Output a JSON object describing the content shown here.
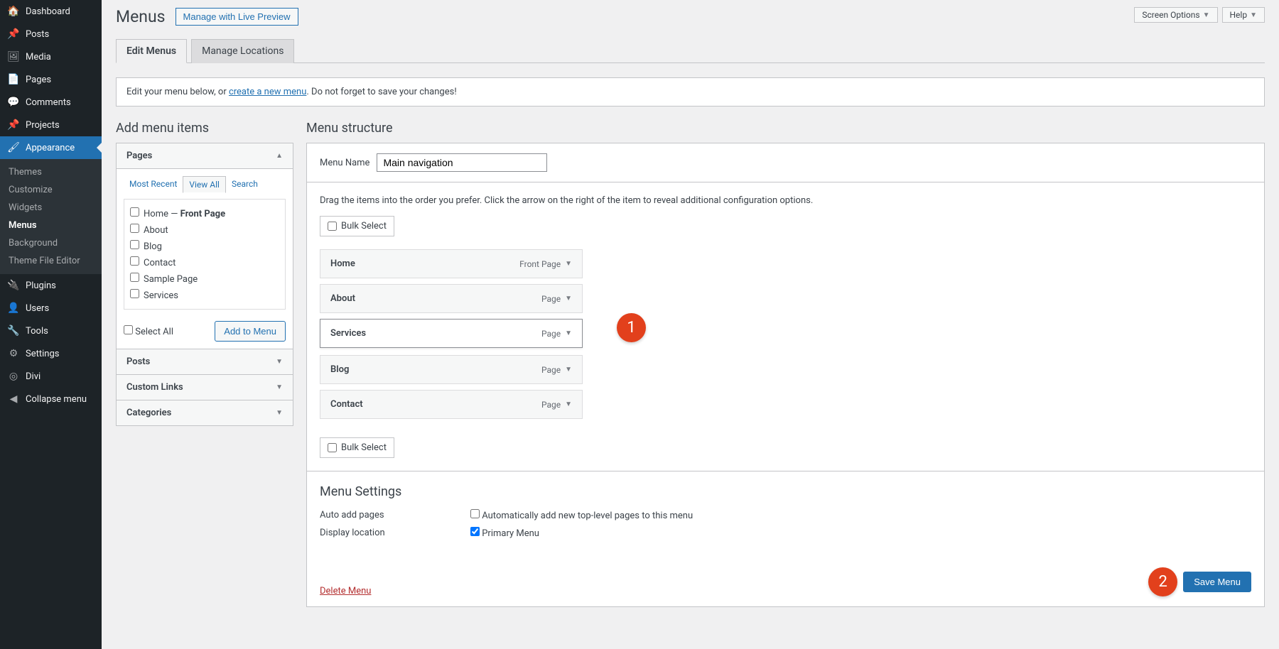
{
  "sidebar": {
    "items": [
      {
        "label": "Dashboard",
        "icon": "🏠"
      },
      {
        "label": "Posts",
        "icon": "📌"
      },
      {
        "label": "Media",
        "icon": "🖼"
      },
      {
        "label": "Pages",
        "icon": "📄"
      },
      {
        "label": "Comments",
        "icon": "💬"
      },
      {
        "label": "Projects",
        "icon": "📌"
      },
      {
        "label": "Appearance",
        "icon": "🖌"
      },
      {
        "label": "Plugins",
        "icon": "🔌"
      },
      {
        "label": "Users",
        "icon": "👤"
      },
      {
        "label": "Tools",
        "icon": "🔧"
      },
      {
        "label": "Settings",
        "icon": "⚙"
      },
      {
        "label": "Divi",
        "icon": "◎"
      },
      {
        "label": "Collapse menu",
        "icon": "◀"
      }
    ],
    "sub": [
      "Themes",
      "Customize",
      "Widgets",
      "Menus",
      "Background",
      "Theme File Editor"
    ]
  },
  "topright": {
    "screen": "Screen Options",
    "help": "Help"
  },
  "title": "Menus",
  "livepreview": "Manage with Live Preview",
  "tabs": {
    "edit": "Edit Menus",
    "locations": "Manage Locations"
  },
  "notice": {
    "pre": "Edit your menu below, or ",
    "link": "create a new menu",
    "post": ". Do not forget to save your changes!"
  },
  "addSection": {
    "title": "Add menu items",
    "panels": [
      "Pages",
      "Posts",
      "Custom Links",
      "Categories"
    ],
    "subtabs": [
      "Most Recent",
      "View All",
      "Search"
    ],
    "pages": [
      {
        "label": "Home — ",
        "suffix": "Front Page"
      },
      {
        "label": "About"
      },
      {
        "label": "Blog"
      },
      {
        "label": "Contact"
      },
      {
        "label": "Sample Page"
      },
      {
        "label": "Services"
      }
    ],
    "selectAll": "Select All",
    "addBtn": "Add to Menu"
  },
  "structure": {
    "title": "Menu structure",
    "nameLabel": "Menu Name",
    "nameValue": "Main navigation",
    "instruction": "Drag the items into the order you prefer. Click the arrow on the right of the item to reveal additional configuration options.",
    "bulk": "Bulk Select",
    "items": [
      {
        "title": "Home",
        "type": "Front Page"
      },
      {
        "title": "About",
        "type": "Page"
      },
      {
        "title": "Services",
        "type": "Page"
      },
      {
        "title": "Blog",
        "type": "Page"
      },
      {
        "title": "Contact",
        "type": "Page"
      }
    ]
  },
  "settings": {
    "title": "Menu Settings",
    "autoLabel": "Auto add pages",
    "autoTxt": "Automatically add new top-level pages to this menu",
    "displayLabel": "Display location",
    "primary": "Primary Menu"
  },
  "footer": {
    "delete": "Delete Menu",
    "save": "Save Menu"
  },
  "badges": {
    "one": "1",
    "two": "2"
  }
}
